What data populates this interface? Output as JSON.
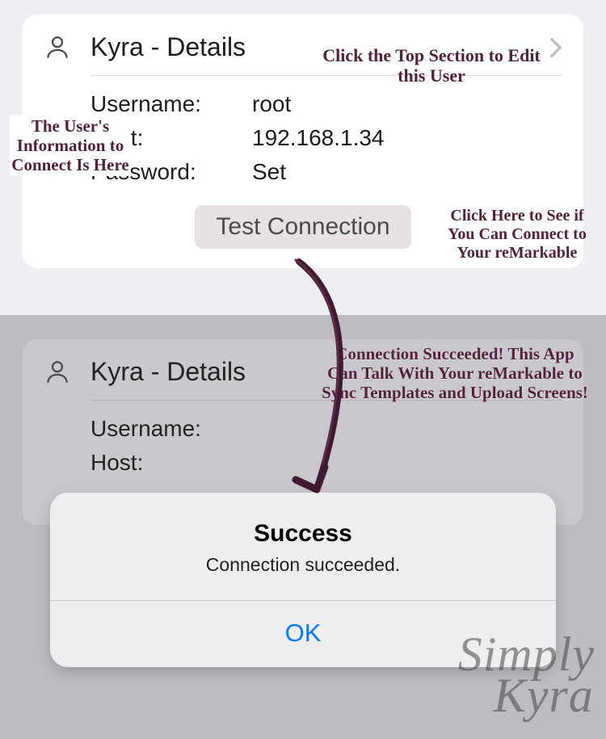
{
  "top": {
    "title": "Kyra - Details",
    "fields": {
      "username_label": "Username:",
      "username_value": "root",
      "host_label": "Host:",
      "host_value": "192.168.1.34",
      "password_label": "Password:",
      "password_value": "Set"
    },
    "test_button": "Test Connection"
  },
  "annotations": {
    "edit_user": "Click the Top Section to Edit this User",
    "user_info": "The User's Information to Connect Is Here",
    "test_hint": "Click Here to See if You Can Connect to Your reMarkable",
    "success_hint": "Connection Succeeded! This App Can Talk With Your reMarkable to Sync Templates and Upload Screens!"
  },
  "bottom": {
    "title": "Kyra - Details",
    "username_label": "Username:",
    "host_label": "Host:"
  },
  "alert": {
    "title": "Success",
    "message": "Connection succeeded.",
    "ok": "OK"
  },
  "watermark": {
    "line1": "Simply",
    "line2": "Kyra"
  }
}
